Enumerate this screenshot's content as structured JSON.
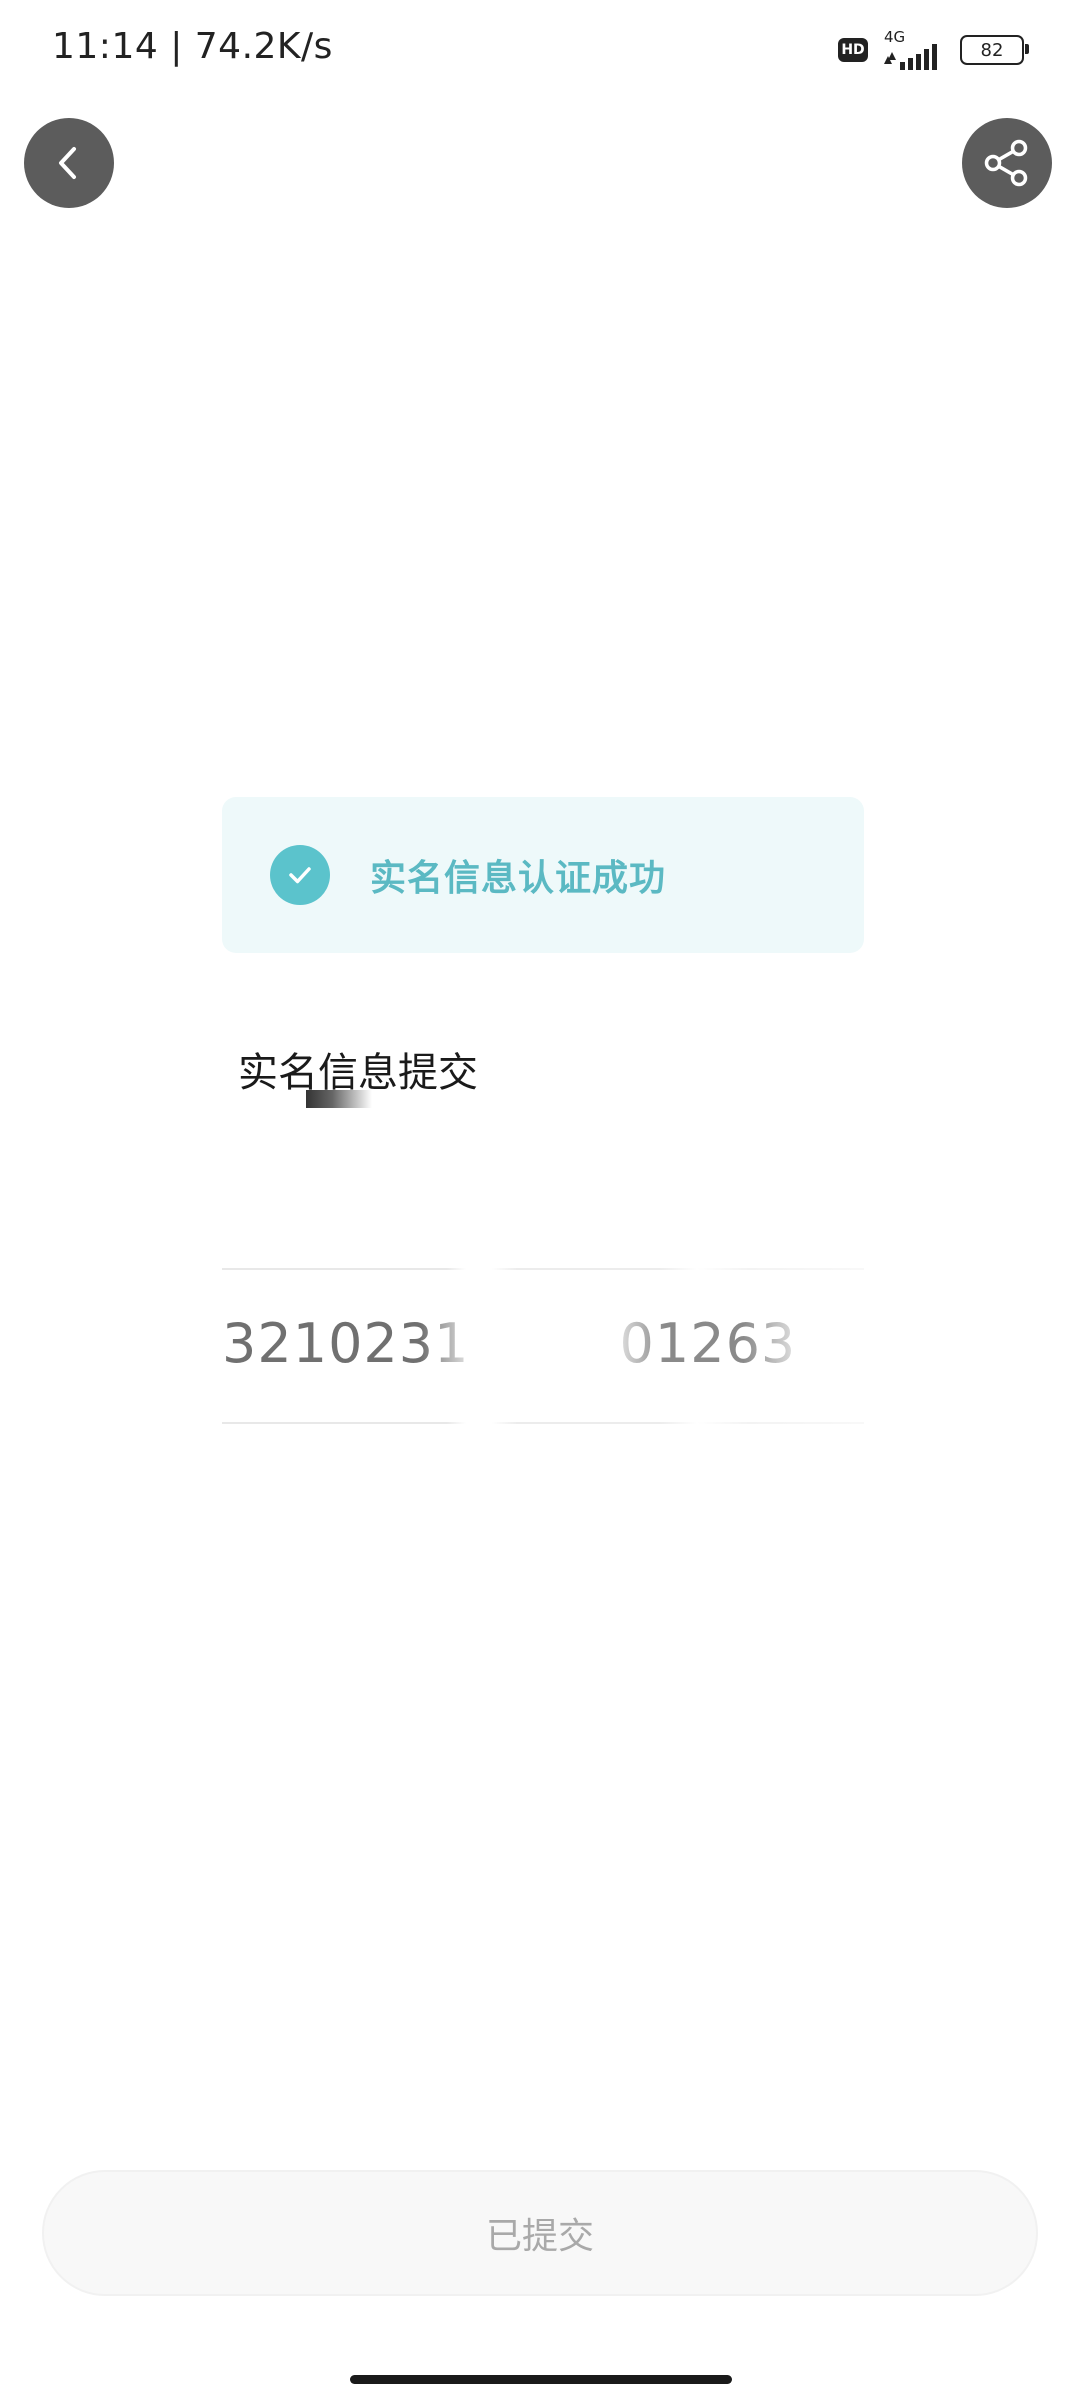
{
  "status_bar": {
    "time_speed": "11:14 | 74.2K/s",
    "hd_label": "HD",
    "network": "4G",
    "battery": "82"
  },
  "icons": {
    "back": "chevron-left-icon",
    "share": "share-icon",
    "success": "check-icon"
  },
  "banner": {
    "text": "实名信息认证成功"
  },
  "section": {
    "title": "实名信息提交"
  },
  "id_field": {
    "part1": "3210231",
    "part2": "01263"
  },
  "submit_button": {
    "label": "已提交"
  },
  "colors": {
    "accent": "#5bc3cc",
    "banner_bg": "#eef9fa",
    "button_bg": "#5c5c5c"
  }
}
